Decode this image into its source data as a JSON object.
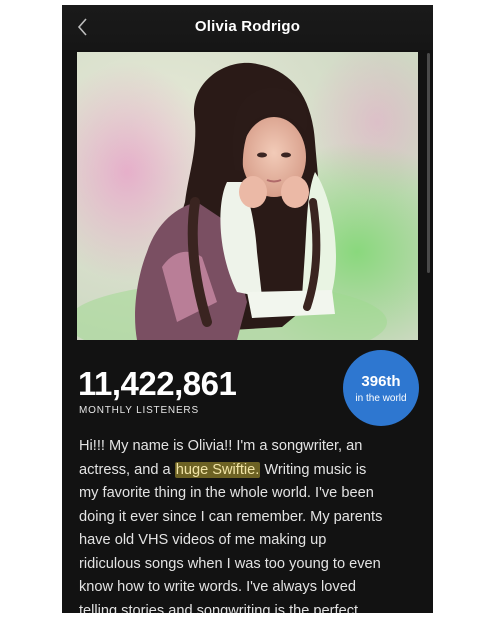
{
  "header": {
    "title": "Olivia Rodrigo",
    "back_icon": "chevron-left-icon"
  },
  "artist": {
    "monthly_listeners": "11,422,861",
    "monthly_listeners_label": "MONTHLY LISTENERS",
    "rank": "396th",
    "rank_label": "in the world"
  },
  "bio": {
    "lines": [
      {
        "before": "Hi!!! My name is Olivia!! I'm a songwriter, an"
      },
      {
        "before": "actress, and a ",
        "highlight": "huge Swiftie.",
        "after": " Writing music is"
      },
      {
        "before": "my favorite thing in the whole world. I've been"
      },
      {
        "before": "doing it ever since I can remember. My parents"
      },
      {
        "before": "have old VHS videos of me making up"
      },
      {
        "before": "ridiculous songs when I was too young to even"
      },
      {
        "before": "know how to write words. I've always loved"
      },
      {
        "before": "telling stories and songwriting is the perfect"
      }
    ]
  },
  "colors": {
    "background": "#121212",
    "rank_badge": "#2e77d0",
    "highlight": "#6d6224"
  }
}
